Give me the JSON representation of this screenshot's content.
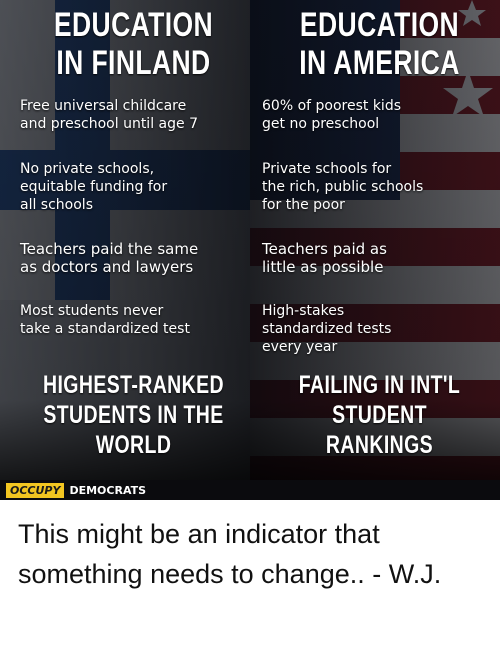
{
  "meme": {
    "left_column": {
      "heading": "EDUCATION\nIN FINLAND",
      "facts": [
        "Free universal childcare\nand preschool until age 7",
        "No private schools,\nequitable funding for\nall schools",
        "Teachers paid the same\nas doctors and lawyers",
        "Most students never\ntake a standardized test"
      ],
      "result": "HIGHEST-RANKED\nSTUDENTS IN THE\nWORLD"
    },
    "right_column": {
      "heading": "EDUCATION\nIN AMERICA",
      "facts": [
        "60% of poorest kids\nget no preschool",
        "Private schools for\nthe rich, public schools\nfor the poor",
        "Teachers paid as\nlittle as possible",
        "High-stakes\nstandardized tests\nevery year"
      ],
      "result": "FAILING IN INT'L\nSTUDENT\nRANKINGS"
    },
    "watermark": {
      "occupy": "OCCUPY",
      "democrats": "DEMOCRATS"
    },
    "colors": {
      "finland_blue": "#2f5fa8",
      "american_red": "#8a1f2b",
      "watermark_yellow": "#f2c521"
    }
  },
  "caption": "This might be an indicator that something needs to change.. - W.J."
}
